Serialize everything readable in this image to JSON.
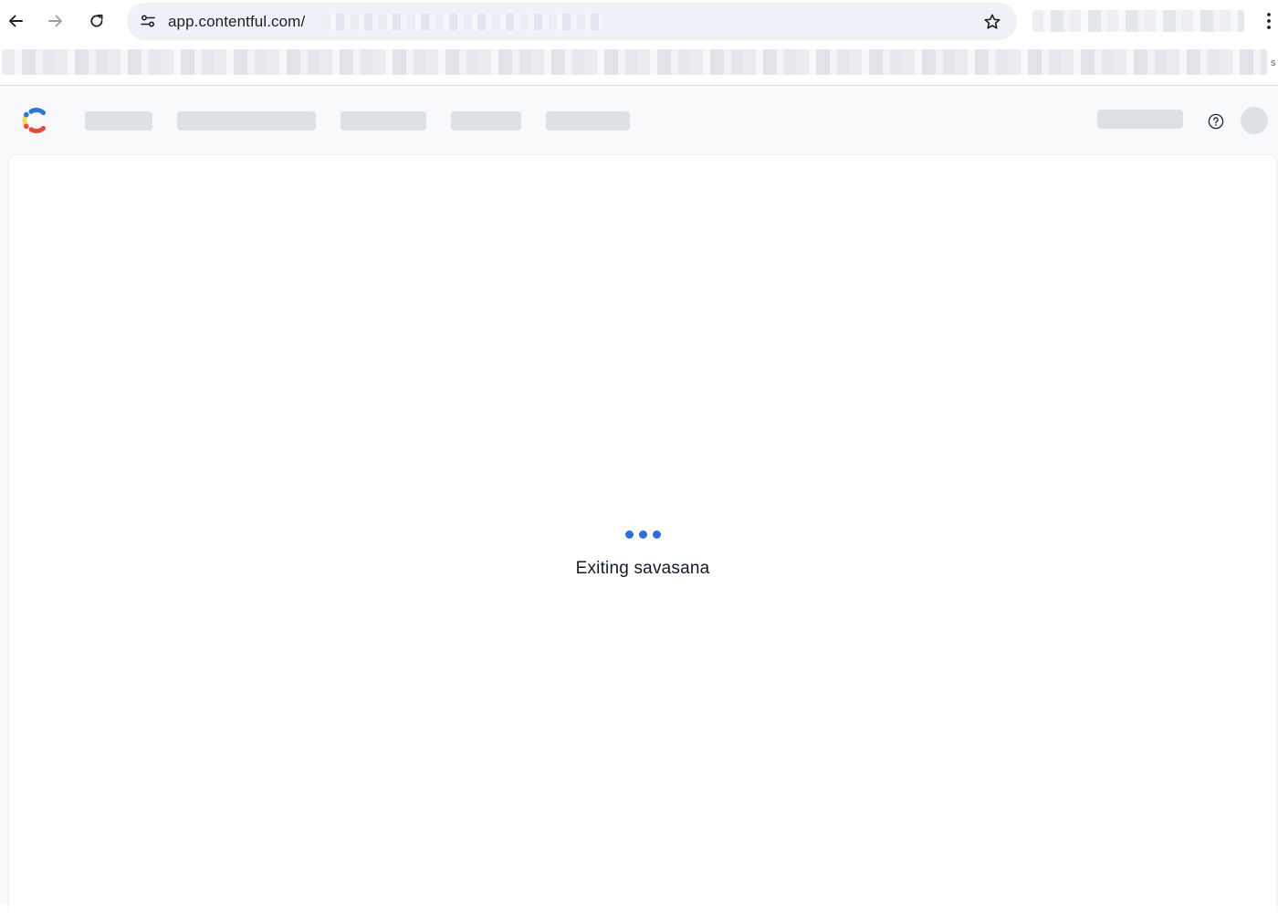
{
  "browser": {
    "url": "app.contentful.com/",
    "bookmark_edge_glyph": "s",
    "icons": {
      "back": "arrow-left-icon",
      "forward": "arrow-right-icon",
      "reload": "reload-icon",
      "site_info": "tune-icon",
      "bookmark": "star-icon",
      "menu": "kebab-menu-icon"
    }
  },
  "app": {
    "logo": "contentful-logo",
    "help_icon": "help-circle-icon",
    "loading": {
      "message": "Exiting savasana",
      "dot_count": 3
    }
  },
  "colors": {
    "loader_dots": "#2f6fdb",
    "skeleton": "#dde1e6",
    "nav_background": "#f7f9fa",
    "logo_yellow": "#ffd84d",
    "logo_blue": "#2e75d4",
    "logo_red": "#e0513b"
  }
}
